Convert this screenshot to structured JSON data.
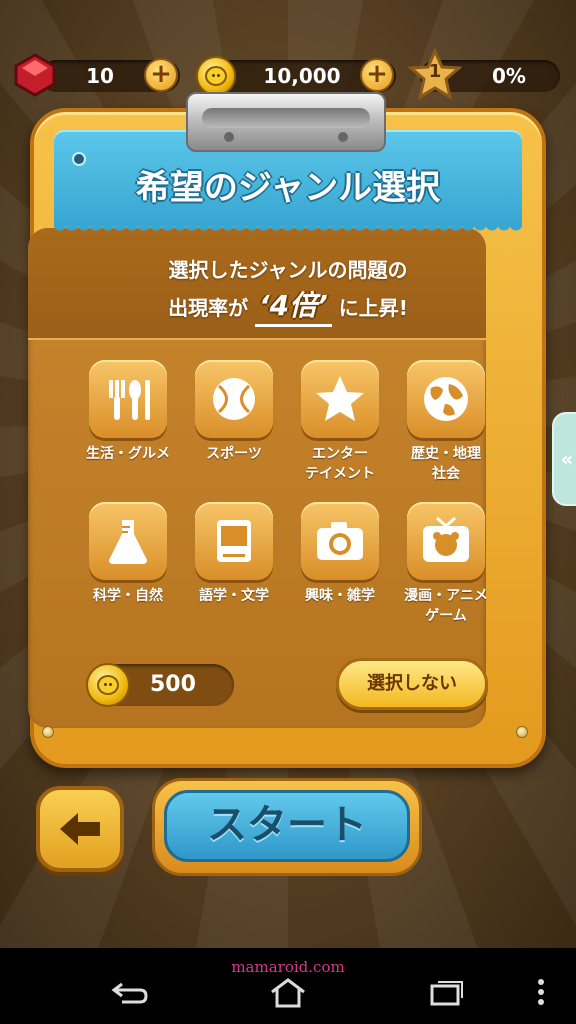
{
  "status": {
    "rubies": "10",
    "coins": "10,000",
    "level": "1",
    "progress": "0%",
    "progress_fraction": 0.0
  },
  "panel": {
    "title": "希望のジャンル選択",
    "desc_line1": "選択したジャンルの問題の",
    "desc_line2_a": "出現率が",
    "desc_highlight": "‘4倍’",
    "desc_line2_b": "に上昇!"
  },
  "genres": [
    {
      "line1": "生活・グルメ",
      "line2": "",
      "icon": "cutlery-icon"
    },
    {
      "line1": "スポーツ",
      "line2": "",
      "icon": "ball-icon"
    },
    {
      "line1": "エンター",
      "line2": "テイメント",
      "icon": "star-icon"
    },
    {
      "line1": "歴史・地理",
      "line2": "社会",
      "icon": "globe-icon"
    },
    {
      "line1": "科学・自然",
      "line2": "",
      "icon": "flask-icon"
    },
    {
      "line1": "語学・文学",
      "line2": "",
      "icon": "book-icon"
    },
    {
      "line1": "興味・雑学",
      "line2": "",
      "icon": "camera-icon"
    },
    {
      "line1": "漫画・アニメ",
      "line2": "ゲーム",
      "icon": "tv-icon"
    }
  ],
  "cost": "500",
  "skip_label": "選択しない",
  "start_label": "スタート",
  "side_tab_label": "«",
  "watermark": "mamaroid.com",
  "colors": {
    "accent_gold": "#f3b71f",
    "banner_blue": "#38a6d2",
    "board_brown": "#b5741f"
  }
}
